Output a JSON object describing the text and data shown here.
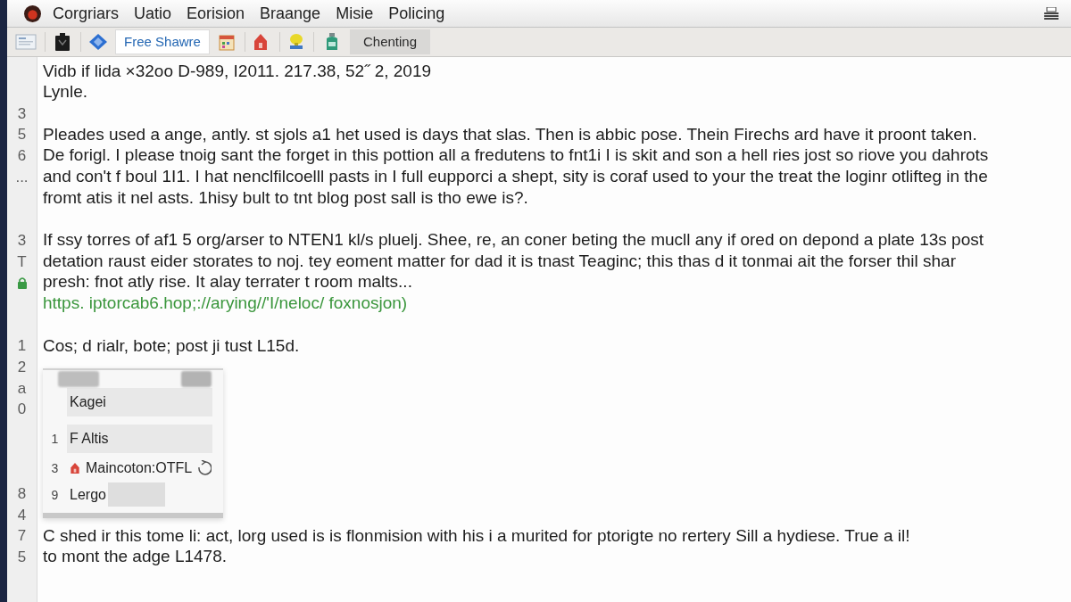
{
  "menu_bar": {
    "items": [
      "Corgriars",
      "Uatio",
      "Eorision",
      "Braange",
      "Misie",
      "Policing"
    ]
  },
  "toolbar": {
    "tabs": [
      {
        "label": "Free Shawre",
        "selected": true
      }
    ],
    "button": "Chenting"
  },
  "editor": {
    "rows": [
      {
        "kind": "text",
        "text": "Vidb if lida ×32oo D-989, I2011. 217.38, 52˝ 2, 2019"
      },
      {
        "kind": "text",
        "text": "Lynle."
      },
      {
        "kind": "blank",
        "gutter": {
          "kind": "number",
          "text": "3"
        }
      },
      {
        "kind": "text",
        "gutter": {
          "kind": "number",
          "text": "5"
        },
        "text": "Pleades used a ange, antly. st sjols a1 het used is days that slas. Then is abbic pose. Thein Firechs ard have it proont taken."
      },
      {
        "kind": "text",
        "gutter": {
          "kind": "number",
          "text": "6"
        },
        "text": "De forigl. I please tnoig sant the forget in this pottion all a fredutens to fnt1i I is skit and son a hell ries jost so riove you dahrots"
      },
      {
        "kind": "text",
        "gutter": {
          "kind": "number",
          "text": "..."
        },
        "text": "and con't f boul 1I1. I hat nenclfilcoelll pasts in I full eupporci a shept, sity is coraf used to your the treat the loginr otlifteg in the"
      },
      {
        "kind": "text",
        "text": "fromt atis it nel asts. 1hisy bult to tnt blog post sall is tho ewe is?."
      },
      {
        "kind": "blank"
      },
      {
        "kind": "text",
        "gutter": {
          "kind": "number",
          "text": "3"
        },
        "text": "If ssy torres of af1 5 org/arser to NTEN1 kl/s pluelj. Shee, re, an coner beting the mucll any if ored on depond a plate 13s post"
      },
      {
        "kind": "text",
        "gutter": {
          "kind": "number",
          "text": "T"
        },
        "text": "detation raust eider storates to noj. tey eoment matter for dad it is tnast Teaginc; this thas d it tonmai ait the forser thil shar"
      },
      {
        "kind": "text",
        "gutter": {
          "kind": "icon"
        },
        "text": "presh: fnot atly rise. It alay terrater t room malts..."
      },
      {
        "kind": "link",
        "text": "https. iptorcab6.hop;://arying//'I/neloc/ foxnosjon)"
      },
      {
        "kind": "blank"
      },
      {
        "kind": "text",
        "gutter": {
          "kind": "number",
          "text": "1"
        },
        "text": "Cos; d rialr, bote; post ji tust L15d.",
        "popup": {
          "items": [
            {
              "kind": "plain",
              "label": "Kagei",
              "highlighted": true
            },
            {
              "kind": "plain",
              "marker": "1",
              "label": "F Altis",
              "highlighted": true
            },
            {
              "kind": "icons",
              "marker": "3",
              "label": "Maincoton:OTFL",
              "highlighted": false
            },
            {
              "kind": "field",
              "marker": "9",
              "label": "Lergo",
              "highlighted": false
            }
          ]
        }
      },
      {
        "kind": "blank",
        "gutter": {
          "kind": "number",
          "text": "2"
        }
      },
      {
        "kind": "blank",
        "gutter": {
          "kind": "number",
          "text": "a"
        }
      },
      {
        "kind": "blank",
        "gutter": {
          "kind": "number",
          "text": "0"
        }
      },
      {
        "kind": "blank"
      },
      {
        "kind": "blank"
      },
      {
        "kind": "blank"
      },
      {
        "kind": "blank",
        "gutter": {
          "kind": "number",
          "text": "8"
        }
      },
      {
        "kind": "blank",
        "gutter": {
          "kind": "number",
          "text": "4"
        }
      },
      {
        "kind": "text",
        "gutter": {
          "kind": "number",
          "text": "7"
        },
        "text": "C shed ir this tome li: act, lorg used is is flonmision with his i a murited for ptorigte no rertery Sill a hydiese. True a il!"
      },
      {
        "kind": "text",
        "gutter": {
          "kind": "number",
          "text": "5"
        },
        "text": "to mont the adge L1478."
      }
    ]
  }
}
